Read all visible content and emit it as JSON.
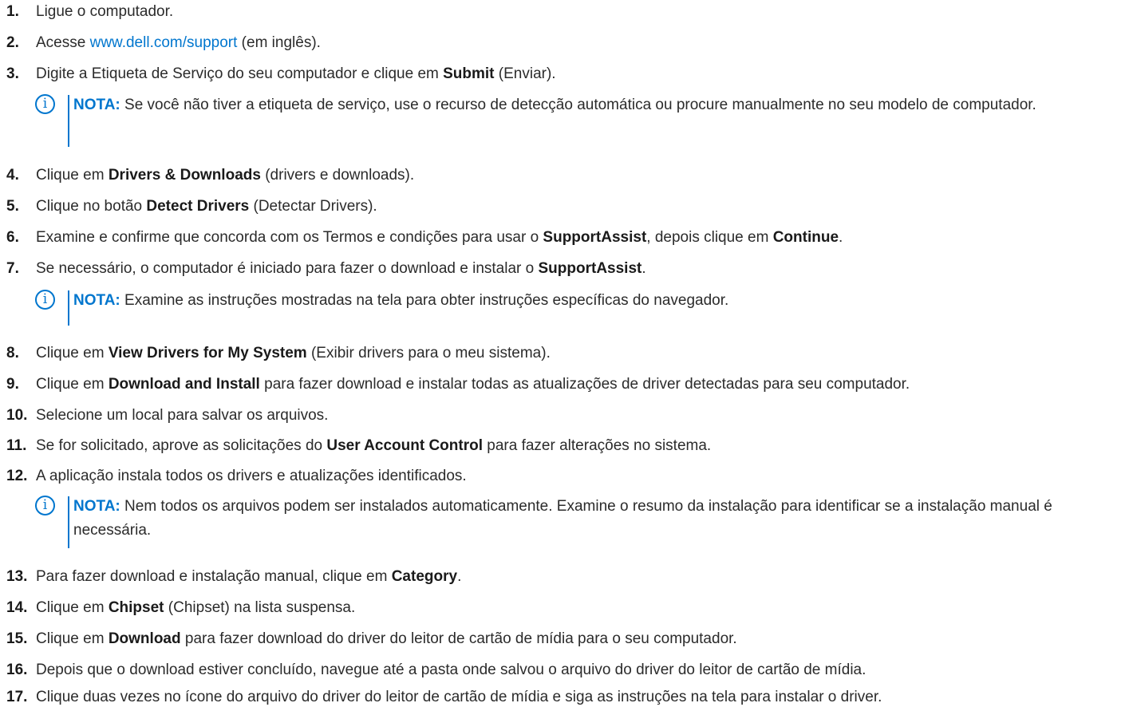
{
  "steps": [
    {
      "num": "1.",
      "t1": "Ligue o computador."
    },
    {
      "num": "2.",
      "t1": "Acesse ",
      "link": "www.dell.com/support",
      "t2": " (em inglês)."
    },
    {
      "num": "3.",
      "t1": "Digite a Etiqueta de Serviço do seu computador e clique em ",
      "b1": "Submit",
      "t2": " (Enviar)."
    },
    {
      "num": "4.",
      "t1": "Clique em ",
      "b1": "Drivers & Downloads",
      "t2": " (drivers e downloads)."
    },
    {
      "num": "5.",
      "t1": "Clique no botão ",
      "b1": "Detect Drivers",
      "t2": " (Detectar Drivers)."
    },
    {
      "num": "6.",
      "t1": "Examine e confirme que concorda com os Termos e condições para usar o ",
      "b1": "SupportAssist",
      "t2": ", depois clique em ",
      "b2": "Continue",
      "t3": "."
    },
    {
      "num": "7.",
      "t1": "Se necessário, o computador é iniciado para fazer o download e instalar o ",
      "b1": "SupportAssist",
      "t2": "."
    },
    {
      "num": "8.",
      "t1": "Clique em ",
      "b1": "View Drivers for My System",
      "t2": " (Exibir drivers para o meu sistema)."
    },
    {
      "num": "9.",
      "t1": "Clique em ",
      "b1": "Download and Install",
      "t2": " para fazer download e instalar todas as atualizações de driver detectadas para seu computador."
    },
    {
      "num": "10.",
      "t1": "Selecione um local para salvar os arquivos."
    },
    {
      "num": "11.",
      "t1": "Se for solicitado, aprove as solicitações do ",
      "b1": "User Account Control",
      "t2": " para fazer alterações no sistema."
    },
    {
      "num": "12.",
      "t1": "A aplicação instala todos os drivers e atualizações identificados."
    },
    {
      "num": "13.",
      "t1": "Para fazer download e instalação manual, clique em ",
      "b1": "Category",
      "t2": "."
    },
    {
      "num": "14.",
      "t1": "Clique em ",
      "b1": "Chipset",
      "t2": " (Chipset) na lista suspensa."
    },
    {
      "num": "15.",
      "t1": "Clique em ",
      "b1": "Download",
      "t2": " para fazer download do driver do leitor de cartão de mídia para o seu computador."
    },
    {
      "num": "16.",
      "t1": "Depois que o download estiver concluído, navegue até a pasta onde salvou o arquivo do driver do leitor de cartão de mídia."
    },
    {
      "num": "17.",
      "t1": "Clique duas vezes no ícone do arquivo do driver do leitor de cartão de mídia e siga as instruções na tela para instalar o driver."
    }
  ],
  "notes": [
    {
      "icon": "i",
      "label": "NOTA:",
      "text": " Se você não tiver a etiqueta de serviço, use o recurso de detecção automática ou procure manualmente no seu modelo de computador."
    },
    {
      "icon": "i",
      "label": "NOTA:",
      "text": " Examine as instruções mostradas na tela para obter instruções específicas do navegador."
    },
    {
      "icon": "i",
      "label": "NOTA:",
      "text": " Nem todos os arquivos podem ser instalados automaticamente. Examine o resumo da instalação para identificar se a instalação manual é necessária."
    }
  ],
  "colors": {
    "accent": "#0076ce",
    "text": "#2b2b2b"
  }
}
